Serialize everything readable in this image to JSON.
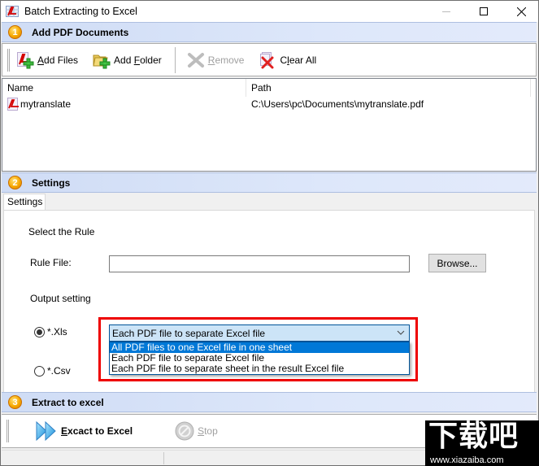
{
  "window": {
    "title": "Batch Extracting to Excel",
    "controls": {
      "minimize": "minimize",
      "maximize": "maximize",
      "close": "close"
    }
  },
  "sections": {
    "add_docs": {
      "number": "1",
      "label": "Add PDF Documents"
    },
    "settings": {
      "number": "2",
      "label": "Settings"
    },
    "extract": {
      "number": "3",
      "label": "Extract to excel"
    }
  },
  "toolbar": {
    "add_files": {
      "pre": "",
      "ul": "A",
      "post": "dd Files",
      "icon": "pdf-add-icon"
    },
    "add_folder": {
      "pre": "Add ",
      "ul": "F",
      "post": "older",
      "icon": "folder-add-icon"
    },
    "remove": {
      "pre": "",
      "ul": "R",
      "post": "emove",
      "icon": "remove-x-icon",
      "disabled": true
    },
    "clear_all": {
      "pre": "C",
      "ul": "l",
      "post": "ear All",
      "icon": "clear-all-icon"
    }
  },
  "file_list": {
    "columns": [
      "Name",
      "Path"
    ],
    "rows": [
      {
        "name": "mytranslate",
        "path": "C:\\Users\\pc\\Documents\\mytranslate.pdf"
      }
    ]
  },
  "settings": {
    "tab": "Settings",
    "select_rule_label": "Select the Rule",
    "rule_file_label": "Rule File:",
    "rule_file_value": "",
    "browse_label": "Browse...",
    "output_setting_label": "Output setting",
    "formats": [
      {
        "label": "*.Xls",
        "checked": true
      },
      {
        "label": "*.Csv",
        "checked": false
      }
    ],
    "rule_combo": {
      "selected": "Each PDF file to separate Excel file",
      "options": [
        "All PDF files to one Excel file in one sheet",
        "Each PDF file to separate Excel file",
        "Each PDF file to separate sheet in the result Excel file"
      ],
      "highlighted_index": 0
    }
  },
  "extract_toolbar": {
    "extract": {
      "pre": "",
      "ul": "E",
      "post": "xcact to Excel"
    },
    "stop": {
      "pre": "",
      "ul": "S",
      "post": "top",
      "disabled": true
    }
  },
  "watermark": {
    "big": "下载吧",
    "url": "www.xiazaiba.com"
  },
  "colors": {
    "section_bg": "#d6e2f8",
    "badge": "#f7a800",
    "highlight": "#0078d7",
    "red_box": "#ee0000"
  }
}
